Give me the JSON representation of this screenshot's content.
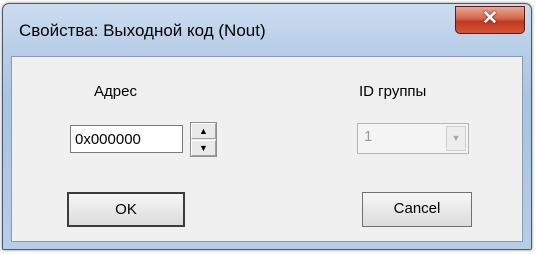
{
  "window": {
    "title": "Свойства: Выходной код (Nout)",
    "close_glyph": "✕"
  },
  "address": {
    "label": "Адрес",
    "value": "0x000000",
    "spin_up": "▲",
    "spin_down": "▼"
  },
  "group": {
    "label": "ID группы",
    "value": "1",
    "dropdown_glyph": "▼",
    "enabled": false
  },
  "buttons": {
    "ok": "OK",
    "cancel": "Cancel"
  }
}
